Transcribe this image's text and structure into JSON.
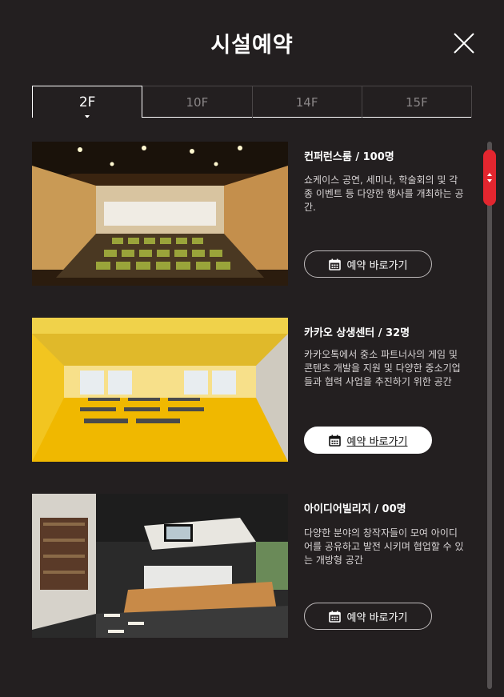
{
  "header": {
    "title": "시설예약",
    "close_icon": "close-icon"
  },
  "tabs": [
    {
      "label": "2F",
      "active": true
    },
    {
      "label": "10F",
      "active": false
    },
    {
      "label": "14F",
      "active": false
    },
    {
      "label": "15F",
      "active": false
    }
  ],
  "facilities": [
    {
      "name": "컨퍼런스룸 / 100명",
      "description": "쇼케이스 공연, 세미나, 학술회의 및 각종 이벤트 등 다양한 행사를 개최하는 공간.",
      "button_label": "예약 바로가기",
      "button_icon": "calendar-icon",
      "image": "conference-room-photo",
      "hovered": false
    },
    {
      "name": "카카오 상생센터 / 32명",
      "description": "카카오톡에서 중소 파트너사의 게임 및 콘텐츠 개발을 지원 및 다양한 중소기업들과 협력 사업을 추진하기 위한 공간",
      "button_label": "예약 바로가기",
      "button_icon": "calendar-icon",
      "image": "coexistence-center-photo",
      "hovered": true
    },
    {
      "name": "아이디어빌리지 / 00명",
      "description": "다양한 분야의 창작자들이 모여 아이디어를 공유하고 발전 시키며 협업할 수 있는 개방형 공간",
      "button_label": "예약 바로가기",
      "button_icon": "calendar-icon",
      "image": "idea-village-photo",
      "hovered": false
    }
  ],
  "colors": {
    "background": "#231f20",
    "accent": "#e3262f",
    "text": "#ffffff"
  }
}
